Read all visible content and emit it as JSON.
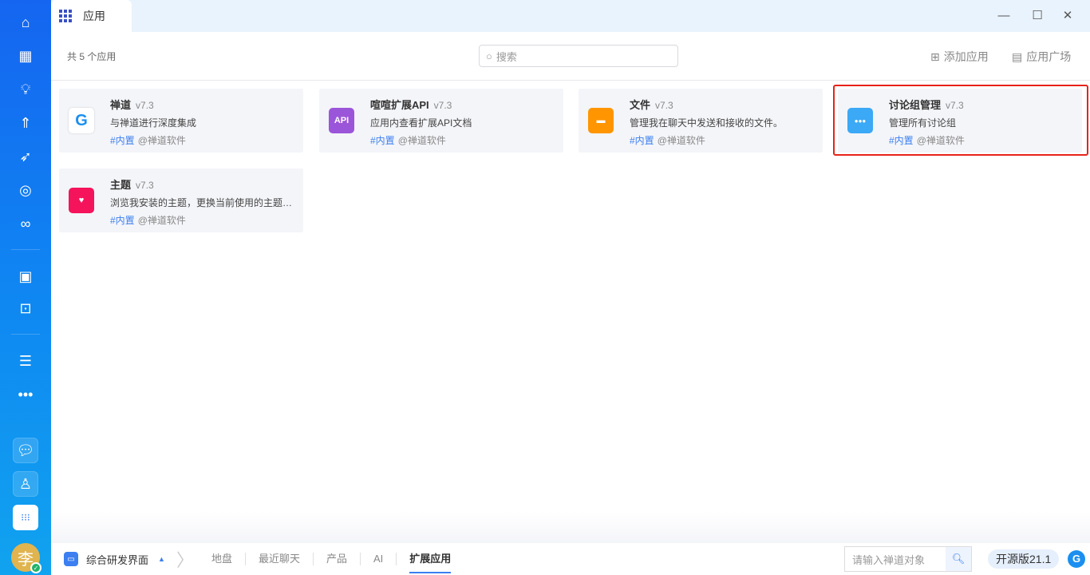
{
  "window": {
    "tab_title": "应用",
    "minimize": "—",
    "maximize": "☐",
    "close": "✕"
  },
  "header": {
    "count_label": "共 5 个应用",
    "search_placeholder": "搜索",
    "add_app": "添加应用",
    "app_market": "应用广场"
  },
  "apps": [
    {
      "name": "禅道",
      "version": "v7.3",
      "desc": "与禅道进行深度集成",
      "tag": "#内置",
      "author": "@禅道软件",
      "icon": "zentao-logo",
      "color": "#ffffff"
    },
    {
      "name": "喧喧扩展API",
      "version": "v7.3",
      "desc": "应用内查看扩展API文档",
      "tag": "#内置",
      "author": "@禅道软件",
      "icon": "api-icon",
      "icon_text": "API",
      "color": "#9b55d9"
    },
    {
      "name": "文件",
      "version": "v7.3",
      "desc": "管理我在聊天中发送和接收的文件。",
      "tag": "#内置",
      "author": "@禅道软件",
      "icon": "folder-icon",
      "color": "#ff9500"
    },
    {
      "name": "讨论组管理",
      "version": "v7.3",
      "desc": "管理所有讨论组",
      "tag": "#内置",
      "author": "@禅道软件",
      "icon": "group-icon",
      "color": "#3ba9f5"
    },
    {
      "name": "主题",
      "version": "v7.3",
      "desc": "浏览我安装的主题，更换当前使用的主题…",
      "tag": "#内置",
      "author": "@禅道软件",
      "icon": "balloon-icon",
      "color": "#f5135c"
    }
  ],
  "sidebar": {
    "avatar_text": "李"
  },
  "bottombar": {
    "workspace": "综合研发界面",
    "nav": [
      "地盘",
      "最近聊天",
      "产品",
      "AI",
      "扩展应用"
    ],
    "search_placeholder": "请输入禅道对象",
    "edition": "开源版21.1"
  }
}
